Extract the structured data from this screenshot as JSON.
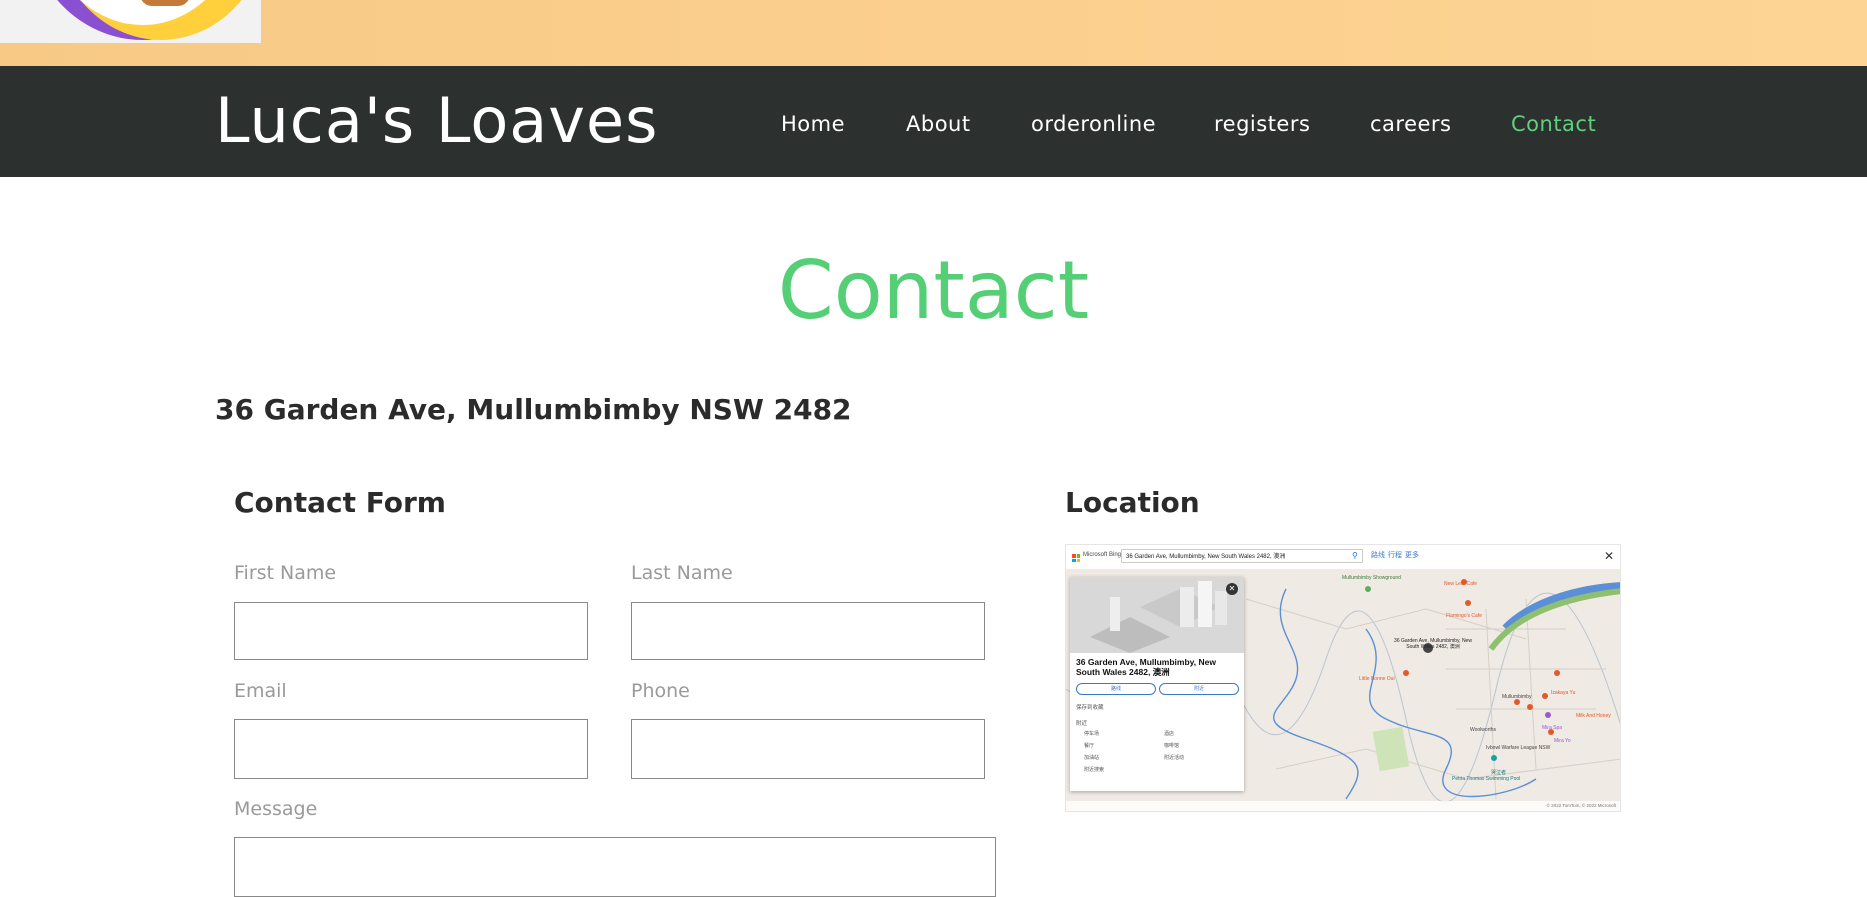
{
  "site": {
    "brand": "Luca's Loaves"
  },
  "nav": {
    "items": [
      {
        "label": "Home"
      },
      {
        "label": "About"
      },
      {
        "label": "orderonline"
      },
      {
        "label": "registers"
      },
      {
        "label": "careers"
      },
      {
        "label": "Contact",
        "active": true
      }
    ],
    "active_color": "#5fd07c"
  },
  "page": {
    "title": "Contact",
    "address": "36 Garden Ave, Mullumbimby NSW 2482"
  },
  "form": {
    "heading": "Contact Form",
    "first_name_label": "First Name",
    "last_name_label": "Last Name",
    "email_label": "Email",
    "phone_label": "Phone",
    "message_label": "Message",
    "first_name_value": "",
    "last_name_value": "",
    "email_value": "",
    "phone_value": "",
    "message_value": ""
  },
  "location": {
    "heading": "Location",
    "map": {
      "provider": "Microsoft Bing",
      "search_text": "36 Garden Ave, Mullumbimby, New South Wales 2482, 澳洲",
      "tools": [
        "路线",
        "行程",
        "更多"
      ],
      "panel_title": "36 Garden Ave, Mullumbimby, New South Wales 2482, 澳洲",
      "panel_buttons": [
        "路线",
        "附近"
      ],
      "save_label": "保存到收藏",
      "nearby_heading": "附近",
      "nearby_items": [
        "停车场",
        "酒店",
        "餐厅",
        "咖啡馆",
        "加油站",
        "附近活动",
        "附近搜索"
      ],
      "pin_label": "36 Garden Ave, Mullumbimby, New South Wales 2482, 澳洲",
      "places": [
        "Mullumbimby Showground",
        "New Leaf Cafe",
        "Flamingo's Cafe",
        "Little Bonne Oui",
        "Mullumbimby",
        "Izakaya Yu",
        "Milk And Honey",
        "Woolworths",
        "Mira Spa",
        "Mira Yo",
        "Ivbowl Warfare League NSW",
        "Petria Thomas Swimming Pool",
        "哭泣者"
      ],
      "footer_text": "© 2022 TomTom, © 2022 Microsoft",
      "colors": {
        "river": "#5b8fd6",
        "park": "#8fc070",
        "pin": "#444444",
        "poi": "#e05a2a"
      }
    }
  }
}
